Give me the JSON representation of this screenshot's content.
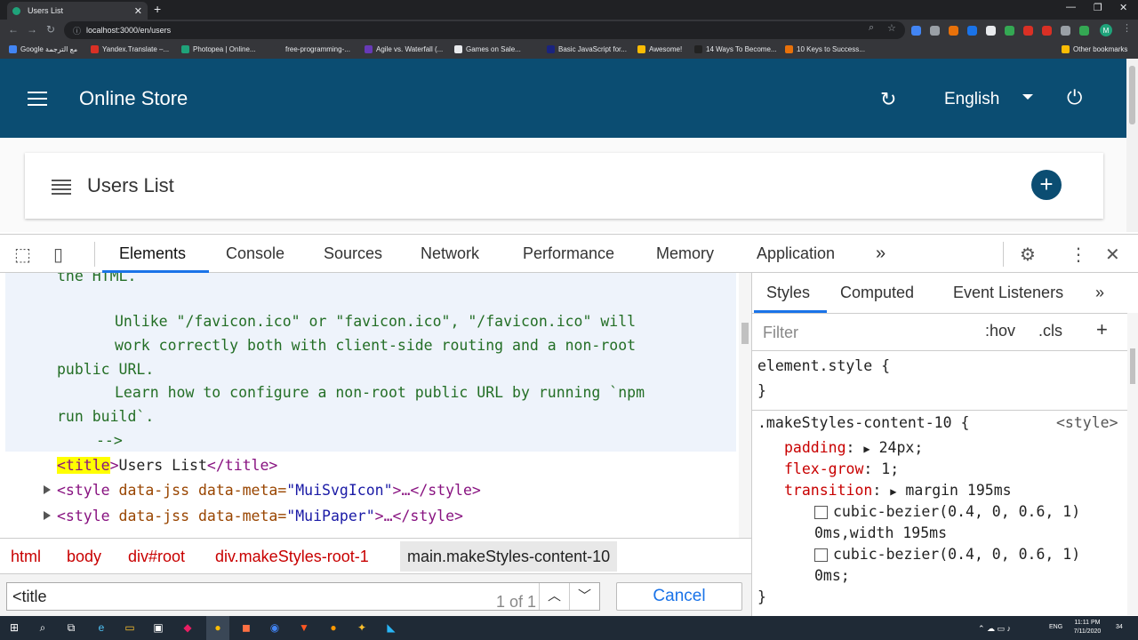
{
  "browser": {
    "tab_title": "Users List",
    "url": "localhost:3000/en/users",
    "bookmarks": [
      "Google مع الترجمة",
      "Yandex.Translate –...",
      "Photopea | Online...",
      "free-programming-...",
      "Agile vs. Waterfall (...",
      "Games on Sale...",
      "Basic JavaScript for...",
      "Awesome!",
      "14 Ways To Become...",
      "10 Keys to Success..."
    ],
    "other_bookmarks": "Other bookmarks",
    "profile_initial": "M"
  },
  "app": {
    "title": "Online Store",
    "language": "English",
    "page_title": "Users List",
    "brand_color": "#0b4d72"
  },
  "devtools": {
    "tabs": [
      "Elements",
      "Console",
      "Sources",
      "Network",
      "Performance",
      "Memory",
      "Application"
    ],
    "active_tab": "Elements",
    "code": {
      "line1": "the HTML.",
      "line2": "Unlike \"/favicon.ico\" or \"favicon.ico\", \"/favicon.ico\" will",
      "line3": "work correctly both with client-side routing and a non-root",
      "line4": "public URL.",
      "line5": "Learn how to configure a non-root public URL by running `npm",
      "line6": "run build`.",
      "line7": "-->",
      "title_open": "<title",
      "title_close": ">",
      "title_text": "Users List",
      "title_end": "</title>",
      "style_open": "<style",
      "attr_jss": " data-jss",
      "attr_meta": " data-meta=",
      "val_svgicon": "\"MuiSvgIcon\"",
      "val_paper": "\"MuiPaper\"",
      "ellipsis": ">…",
      "style_close": "</style>"
    },
    "breadcrumbs": [
      "html",
      "body",
      "div#root",
      "div.makeStyles-root-1",
      "main.makeStyles-content-10"
    ],
    "search": {
      "value": "<title",
      "match_count": "1 of 1",
      "cancel_label": "Cancel"
    },
    "styles": {
      "tabs": [
        "Styles",
        "Computed",
        "Event Listeners"
      ],
      "filter_placeholder": "Filter",
      "hov": ":hov",
      "cls": ".cls",
      "element_style": "element.style {",
      "brace_close": "}",
      "selector": ".makeStyles-content-10 {",
      "source": "<style>",
      "rules": [
        {
          "prop": "padding",
          "value": "24px;"
        },
        {
          "prop": "flex-grow",
          "value": "1;"
        },
        {
          "prop": "transition",
          "value": "margin 195ms"
        }
      ],
      "bezier1": "cubic-bezier(0.4, 0, 0.6, 1)",
      "cont1": "0ms,width 195ms",
      "bezier2": "cubic-bezier(0.4, 0, 0.6, 1)",
      "cont2": "0ms;"
    }
  },
  "taskbar": {
    "lang": "ENG",
    "time": "11:11 PM",
    "date": "7/11/2020",
    "notifications": "34"
  }
}
